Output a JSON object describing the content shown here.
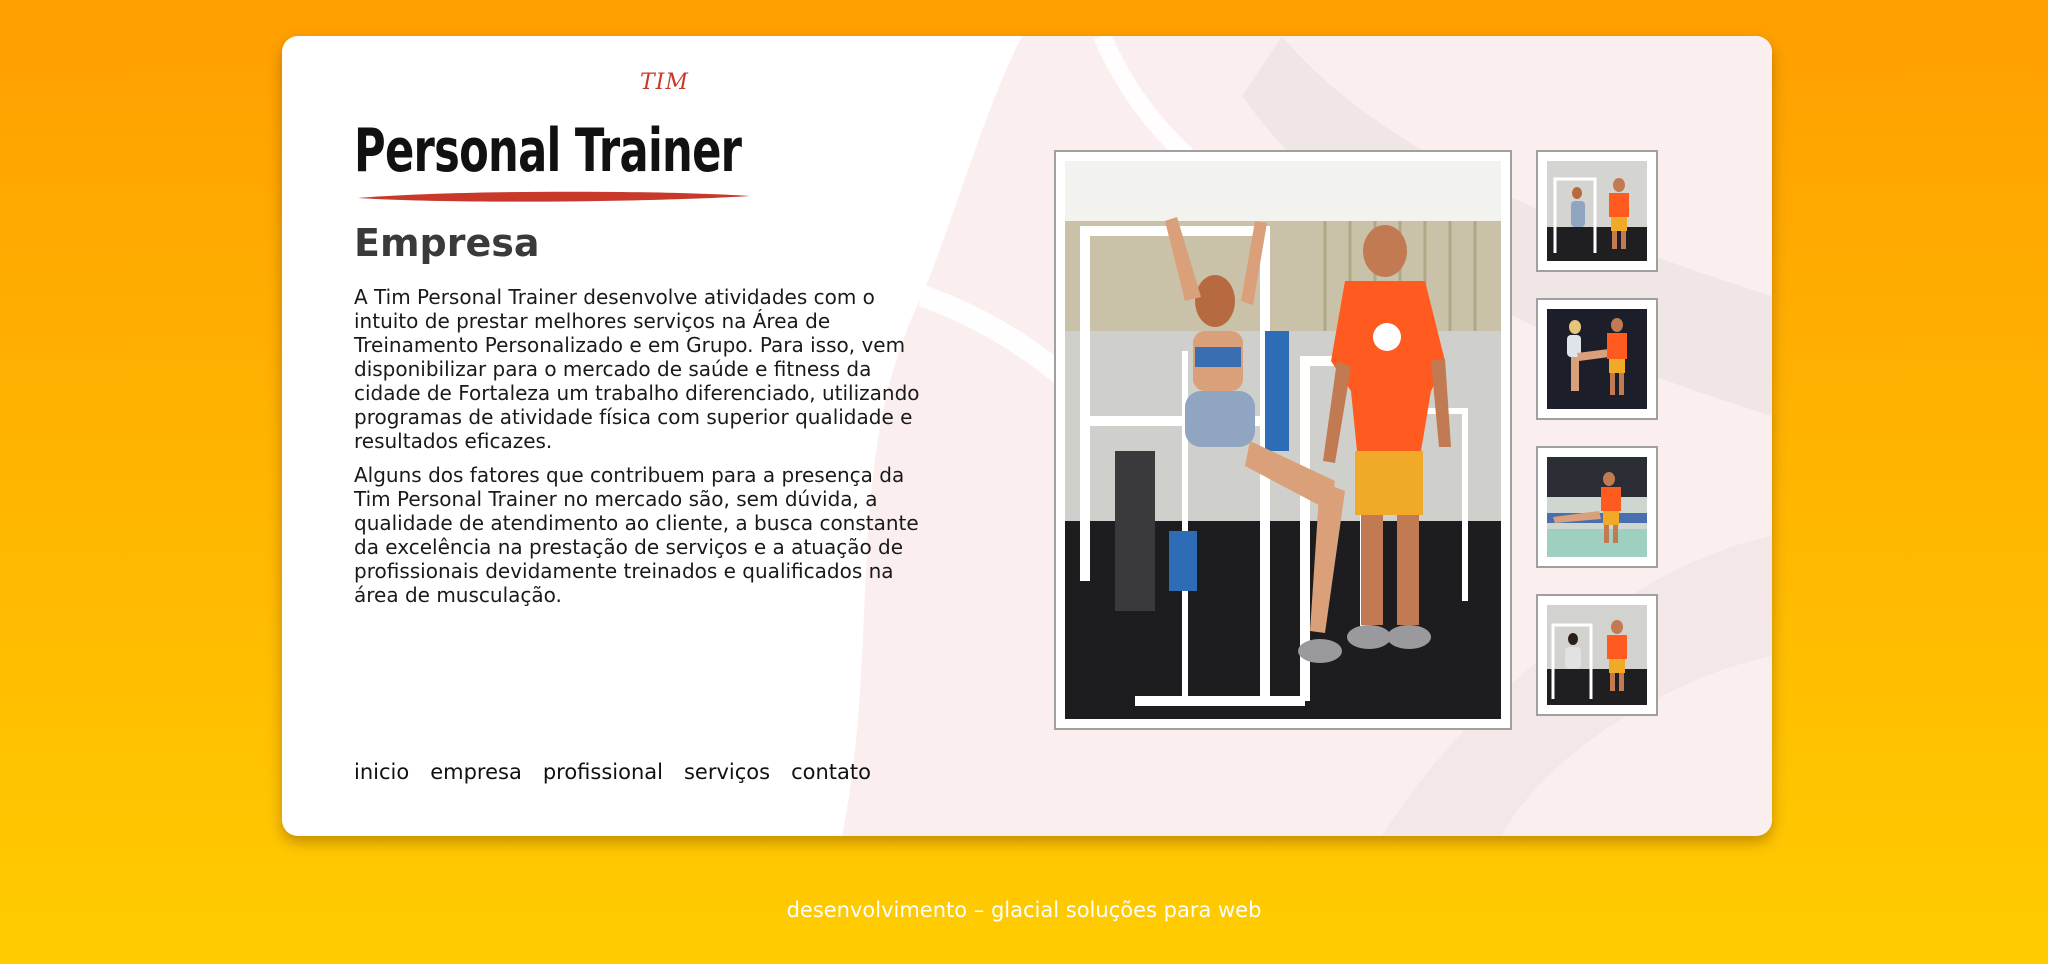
{
  "logo": {
    "tag": "TIM",
    "name": "Personal Trainer"
  },
  "heading": "Empresa",
  "paragraphs": [
    "A Tim Personal Trainer desenvolve atividades com o intuito de prestar melhores serviços na Área de Treinamento Personalizado e em Grupo. Para isso, vem disponibilizar para o mercado de saúde e fitness da cidade de Fortaleza um trabalho diferenciado, utilizando programas de atividade física com superior qualidade e resultados eficazes.",
    "Alguns dos fatores que contribuem para a presença da Tim Personal Trainer no mercado são, sem dúvida, a qualidade de atendimento ao cliente, a busca constante da excelência na prestação de serviços e a atuação de profissionais devidamente treinados e qualificados na área de musculação."
  ],
  "nav": [
    "inicio",
    "empresa",
    "profissional",
    "serviços",
    "contato"
  ],
  "footer": "desenvolvimento – glacial soluções para web",
  "colors": {
    "background_top": "#ff9f00",
    "background_bottom": "#ffcc00",
    "heading": "#3a3a3a",
    "logo_accent": "#c8392b",
    "trainer_shirt": "#ff5a1f"
  }
}
